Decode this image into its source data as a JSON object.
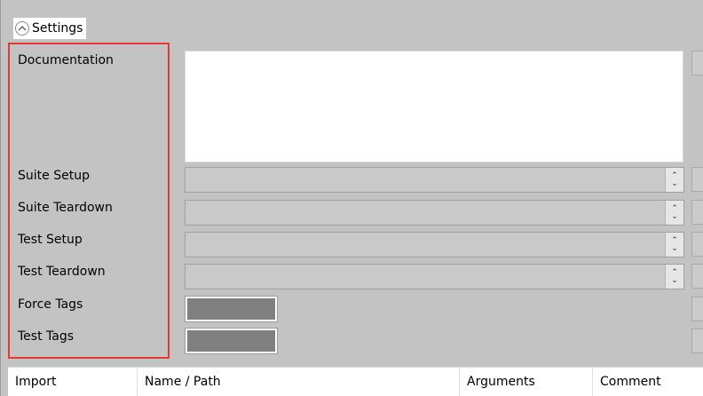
{
  "settings": {
    "toggle_label": "Settings"
  },
  "fields": {
    "documentation": "Documentation",
    "suite_setup": "Suite Setup",
    "suite_teardown": "Suite Teardown",
    "test_setup": "Test Setup",
    "test_teardown": "Test Teardown",
    "force_tags": "Force Tags",
    "test_tags": "Test Tags"
  },
  "spin_glyphs": {
    "up": "⌃",
    "down": "⌄"
  },
  "table": {
    "columns": [
      "Import",
      "Name / Path",
      "Arguments",
      "Comment"
    ]
  },
  "colors": {
    "highlight_border": "#e53935",
    "panel_bg": "#c3c3c3"
  }
}
